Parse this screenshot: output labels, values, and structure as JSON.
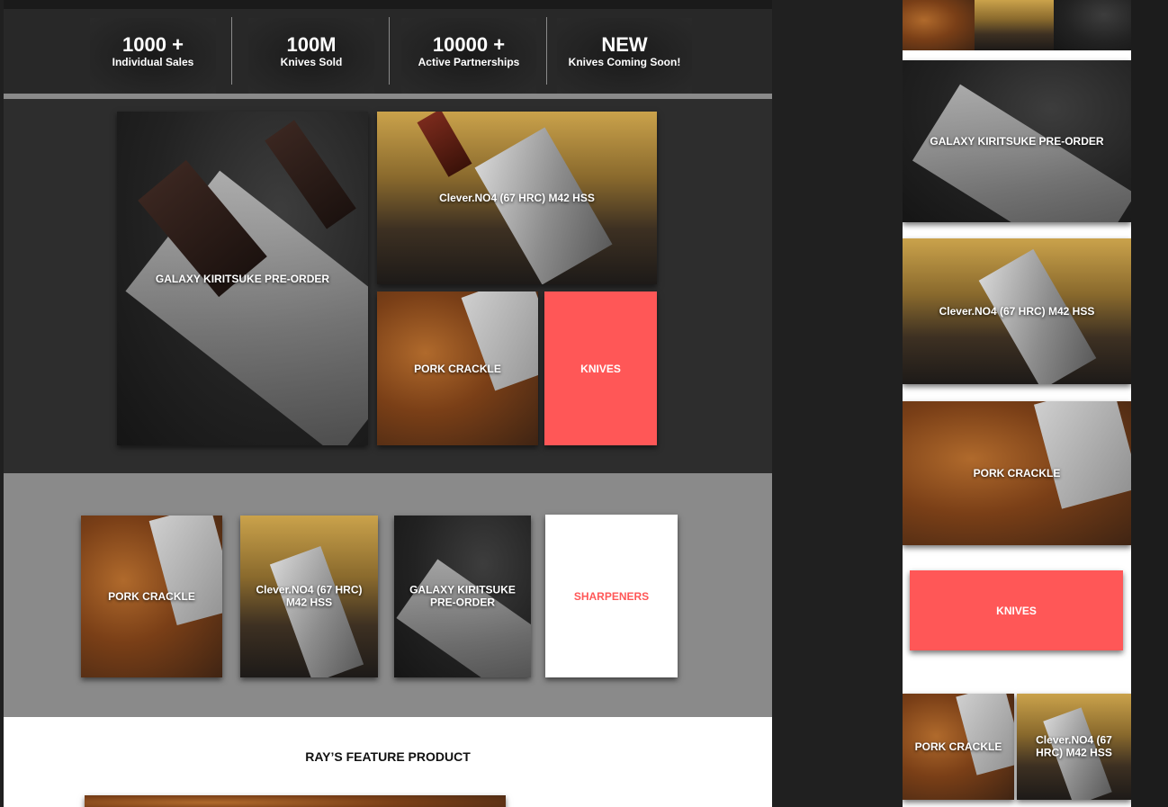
{
  "stats": [
    {
      "value": "1000 +",
      "label": "Individual Sales"
    },
    {
      "value": "100M",
      "label": "Knives Sold"
    },
    {
      "value": "10000 +",
      "label": "Active Partnerships"
    },
    {
      "value": "NEW",
      "label": "Knives Coming Soon!"
    }
  ],
  "grid1": {
    "galaxy": "GALAXY KIRITSUKE PRE-ORDER",
    "clever": "Clever.NO4 (67 HRC) M42 HSS",
    "pork": "PORK CRACKLE",
    "knives": "KNIVES"
  },
  "grid2": {
    "pork": "PORK CRACKLE",
    "clever": "Clever.NO4 (67 HRC) M42 HSS",
    "galaxy": "GALAXY KIRITSUKE PRE-ORDER",
    "sharpeners": "SHARPENERS"
  },
  "feature": {
    "title": "RAY’S FEATURE PRODUCT"
  },
  "mobile": {
    "galaxy": "GALAXY KIRITSUKE PRE-ORDER",
    "clever": "Clever.NO4 (67 HRC) M42 HSS",
    "pork": "PORK CRACKLE",
    "knives": "KNIVES",
    "pork_small": "PORK CRACKLE",
    "clever_small": "Clever.NO4 (67 HRC) M42 HSS"
  },
  "colors": {
    "accent": "#ff5757",
    "dark": "#2d2d2d",
    "gray": "#8a8a8a"
  }
}
